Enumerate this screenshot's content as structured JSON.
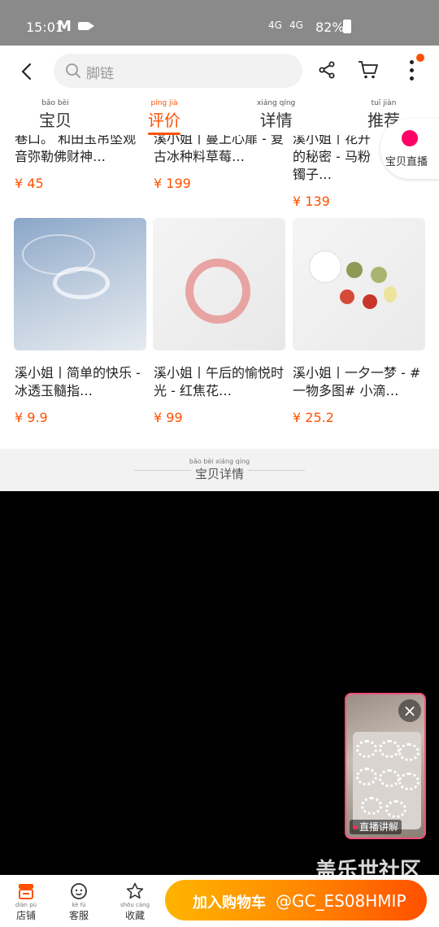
{
  "status_bar": {
    "time": "15:01",
    "mail_icon": "M",
    "network1": "4G",
    "network2": "4G",
    "battery": "82%"
  },
  "search": {
    "placeholder": "脚链"
  },
  "tabs": [
    {
      "label": "宝贝",
      "pinyin": "bǎo bèi",
      "active": false
    },
    {
      "label": "评价",
      "pinyin": "píng jià",
      "active": true
    },
    {
      "label": "详情",
      "pinyin": "xiáng qíng",
      "active": false
    },
    {
      "label": "推荐",
      "pinyin": "tuī jiàn",
      "active": false
    }
  ],
  "products": [
    {
      "name": "巷口。 和田玉吊坠观音弥勒佛财神…",
      "price": "¥ 45"
    },
    {
      "name": "溪小姐丨蔓上心扉 - 复古冰种料草莓…",
      "price": "¥ 199"
    },
    {
      "name": "溪小姐丨花开的秘密 - 马粉镯子…",
      "price": "¥ 139"
    },
    {
      "name": "溪小姐丨简单的快乐 - 冰透玉髓指…",
      "price": "¥ 9.9"
    },
    {
      "name": "溪小姐丨午后的愉悦时光 - 红焦花…",
      "price": "¥ 99"
    },
    {
      "name": "溪小姐丨一夕一梦 - #一物多图# 小滴…",
      "price": "¥ 25.2"
    }
  ],
  "floating": {
    "label": "宝贝直播"
  },
  "detail_header": {
    "title": "宝贝详情",
    "pinyin": "bǎo bèi xiáng qíng"
  },
  "live": {
    "tag": "直播讲解",
    "close": "×"
  },
  "watermark": "盖乐世社区",
  "bottom": {
    "shop": {
      "label": "店铺",
      "pinyin": "diàn pù"
    },
    "service": {
      "label": "客服",
      "pinyin": "kè fú"
    },
    "favorite": {
      "label": "收藏",
      "pinyin": "shōu cáng"
    },
    "add_cart": "加入购物车",
    "buy": "@GC_ES08HMIP"
  },
  "colors": {
    "accent": "#ff5000",
    "live_border": "#ff4d7a"
  }
}
